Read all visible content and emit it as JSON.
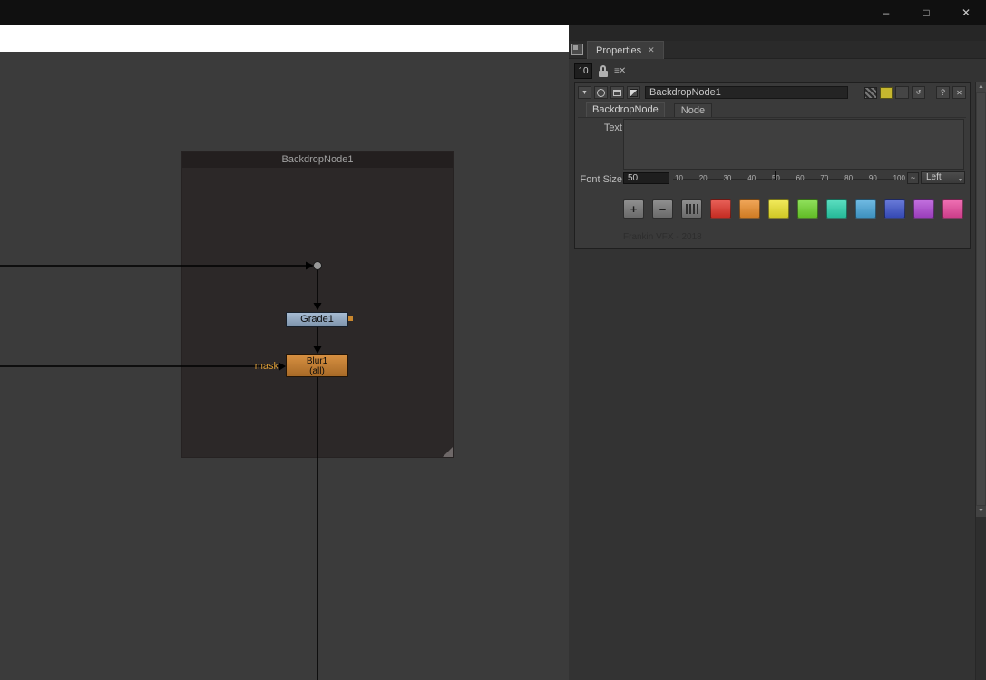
{
  "titlebar": {},
  "icons": {
    "minimize": "–",
    "maximize": "□",
    "close": "✕",
    "tab_close": "✕",
    "clear_panels": "≡✕",
    "collapse": "▼",
    "curve": "~",
    "loop": "↺",
    "dropdown_arrow": "▾",
    "scroll_up": "▲",
    "scroll_down": "▼",
    "plus": "+",
    "minus": "–"
  },
  "dag": {
    "backdrop_title": "BackdropNode1",
    "grade_node_label": "Grade1",
    "blur_node_label_line1": "Blur1",
    "blur_node_label_line2": "(all)",
    "mask_input_label": "mask"
  },
  "properties_panel": {
    "tab_label": "Properties",
    "max_panels_value": "10",
    "node_panel": {
      "name_value": "BackdropNode1",
      "tabs": [
        {
          "label": "BackdropNode"
        },
        {
          "label": "Node"
        }
      ],
      "text_label": "Text",
      "text_value": "",
      "font_size_label": "Font Size",
      "font_size_value": "50",
      "slider_ticks": [
        "10",
        "20",
        "30",
        "40",
        "50",
        "60",
        "70",
        "80",
        "90",
        "100"
      ],
      "align_value": "Left",
      "help_icon": "?",
      "close_icon": "✕",
      "swatches": [
        "#e03227",
        "#eb8c28",
        "#ece32b",
        "#6fd62c",
        "#2bd3ad",
        "#46a5d9",
        "#3c53cc",
        "#af46d4",
        "#e8469c"
      ],
      "footer_text": "Frankin VFX - 2018"
    }
  }
}
